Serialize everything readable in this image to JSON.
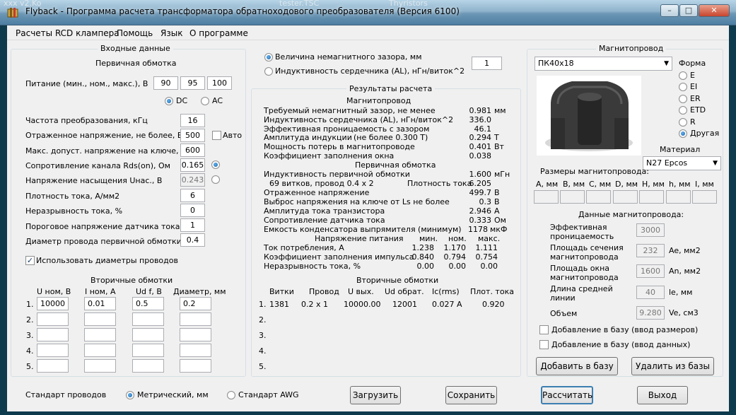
{
  "window": {
    "title": "Flyback - Программа расчета трансформатора обратноходового преобразователя (Версия 6100)",
    "bg_ghost": [
      "xxx v2.Ko",
      "tester.TSC",
      "Thyristors"
    ]
  },
  "menu": [
    "Расчеты RCD клампера",
    "Помощь",
    "Язык",
    "О программе"
  ],
  "input": {
    "title": "Входные данные",
    "primary_title": "Первичная обмотка",
    "supply_label": "Питание (мин., ном., макс.), В",
    "supply": [
      "90",
      "95",
      "100"
    ],
    "dc": "DC",
    "ac": "AC",
    "rows": [
      {
        "label": "Частота преобразования, кГц",
        "value": "16"
      },
      {
        "label": "Отраженное напряжение, не более, В",
        "value": "500"
      },
      {
        "label": "Макс. допуст. напряжение на ключе, В",
        "value": "600"
      },
      {
        "label": "Сопротивление канала Rds(on), Ом",
        "value": "0.165"
      },
      {
        "label": "Напряжение насыщения Uнас., В",
        "value": "0.243"
      },
      {
        "label": "Плотность тока, А/мм2",
        "value": "6"
      },
      {
        "label": "Неразрывность тока, %",
        "value": "0"
      },
      {
        "label": "Пороговое напряжение датчика тока, В",
        "value": "1"
      },
      {
        "label": "Диаметр провода первичной обмотки, мм",
        "value": "0.4"
      }
    ],
    "auto_label": "Авто",
    "use_diam_label": "Использовать диаметры проводов",
    "secondary_title": "Вторичные обмотки",
    "sec_headers": [
      "U ном, В",
      "I ном, А",
      "Ud f, В",
      "Диаметр, мм"
    ],
    "sec_rows": [
      {
        "n": "1.",
        "u": "10000",
        "i": "0.01",
        "ud": "0.5",
        "d": "0.2"
      },
      {
        "n": "2.",
        "u": "",
        "i": "",
        "ud": "",
        "d": ""
      },
      {
        "n": "3.",
        "u": "",
        "i": "",
        "ud": "",
        "d": ""
      },
      {
        "n": "4.",
        "u": "",
        "i": "",
        "ud": "",
        "d": ""
      },
      {
        "n": "5.",
        "u": "",
        "i": "",
        "ud": "",
        "d": ""
      }
    ]
  },
  "gap": {
    "opt1": "Величина немагнитного зазора, мм",
    "opt2": "Индуктивность сердечника (AL), нГн/виток^2",
    "value": "1"
  },
  "results": {
    "title": "Результаты расчета",
    "core_title": "Магнитопровод",
    "core_rows": [
      {
        "l": "Требуемый немагнитный зазор, не менее",
        "v": "0.981",
        "u": "мм"
      },
      {
        "l": "Индуктивность сердечника (AL), нГн/виток^2",
        "v": "336.0",
        "u": ""
      },
      {
        "l": "Эффективная проницаемость с зазором",
        "v": "46.1",
        "u": ""
      },
      {
        "l": "Амплитуда индукции",
        "m": "(не более 0.300 Т)",
        "v": "0.294",
        "u": "Т"
      },
      {
        "l": "Мощность потерь в магнитопроводе",
        "v": "0.401",
        "u": "Вт"
      },
      {
        "l": "Коэффициент заполнения окна",
        "v": "0.038",
        "u": ""
      }
    ],
    "prim_title": "Первичная обмотка",
    "prim_ind": {
      "l": "Индуктивность первичной обмотки",
      "v": "1.600",
      "u": "мГн"
    },
    "prim_turns": "69 витков, провод 0.4 x 2",
    "density_label": "Плотность тока",
    "density_value": "6.205",
    "prim_rows": [
      {
        "l": "Отраженное напряжение",
        "v": "499.7",
        "u": "В"
      },
      {
        "l": "Выброс напряжения на ключе от Ls не более",
        "v": "0.3",
        "u": "В"
      },
      {
        "l": "Амплитуда тока транзистора",
        "v": "2.946",
        "u": "А"
      },
      {
        "l": "Сопротивление датчика тока",
        "v": "0.333",
        "u": "Ом"
      },
      {
        "l": "Емкость конденсатора выпрямителя (минимум)",
        "v": "1178",
        "u": "мкФ"
      }
    ],
    "supply_hdr": "Напряжение питания",
    "col_hdrs": [
      "мин.",
      "ном.",
      "макс."
    ],
    "tri_rows": [
      {
        "l": "Ток потребления, А",
        "a": "1.238",
        "b": "1.170",
        "c": "1.111"
      },
      {
        "l": "Коэффициент заполнения импульса",
        "a": "0.840",
        "b": "0.794",
        "c": "0.754"
      },
      {
        "l": "Неразрывность тока, %",
        "a": "0.00",
        "b": "0.00",
        "c": "0.00"
      }
    ],
    "sec_title": "Вторичные обмотки",
    "sec_hdrs": [
      "Витки",
      "Провод",
      "U вых.",
      "Ud обрат.",
      "Ic(rms)",
      "Плот. тока"
    ],
    "sec_rows": [
      {
        "n": "1.",
        "t": "1381",
        "w": "0.2 x 1",
        "u": "10000.00",
        "ud": "12001",
        "ic": "0.027 А",
        "d": "0.920"
      },
      {
        "n": "2.",
        "t": "",
        "w": "",
        "u": "",
        "ud": "",
        "ic": "",
        "d": ""
      },
      {
        "n": "3.",
        "t": "",
        "w": "",
        "u": "",
        "ud": "",
        "ic": "",
        "d": ""
      },
      {
        "n": "4.",
        "t": "",
        "w": "",
        "u": "",
        "ud": "",
        "ic": "",
        "d": ""
      },
      {
        "n": "5.",
        "t": "",
        "w": "",
        "u": "",
        "ud": "",
        "ic": "",
        "d": ""
      }
    ]
  },
  "core": {
    "title": "Магнитопровод",
    "selected": "ПК40x18",
    "shape_title": "Форма",
    "shapes": [
      "E",
      "EI",
      "ER",
      "ETD",
      "R",
      "Другая"
    ],
    "selected_shape": "Другая",
    "material_title": "Материал",
    "material": "N27 Epcos",
    "dims_title": "Размеры магнитопровода:",
    "dims": [
      "А, мм",
      "В, мм",
      "С, мм",
      "D, мм",
      "Н, мм",
      "h, мм",
      "I, мм"
    ],
    "data_title": "Данные магнитопровода:",
    "params": [
      {
        "l1": "Эффективная",
        "l2": "проницаемость",
        "v": "3000",
        "u": ""
      },
      {
        "l1": "Площадь сечения",
        "l2": "магнитопровода",
        "v": "232",
        "u": "Ae, мм2"
      },
      {
        "l1": "Площадь окна",
        "l2": "магнитопровода",
        "v": "1600",
        "u": "An, мм2"
      },
      {
        "l1": "Длина средней",
        "l2": "линии",
        "v": "40",
        "u": "le, мм"
      },
      {
        "l1": "Объем",
        "l2": "",
        "v": "9.280",
        "u": "Ve, см3"
      }
    ],
    "add_dims": "Добавление в базу (ввод размеров)",
    "add_data": "Добавление в базу (ввод данных)",
    "add_btn": "Добавить в базу",
    "del_btn": "Удалить из базы"
  },
  "bottom": {
    "std_label": "Стандарт проводов",
    "metric": "Метрический, мм",
    "awg": "Стандарт AWG",
    "load": "Загрузить",
    "save": "Сохранить",
    "calc": "Рассчитать",
    "exit": "Выход"
  },
  "colors": {
    "titlebar": "#8fb3cc",
    "desktop": "#0e3a4e",
    "panel": "#f0f0f0",
    "accent": "#3c7fb1"
  }
}
